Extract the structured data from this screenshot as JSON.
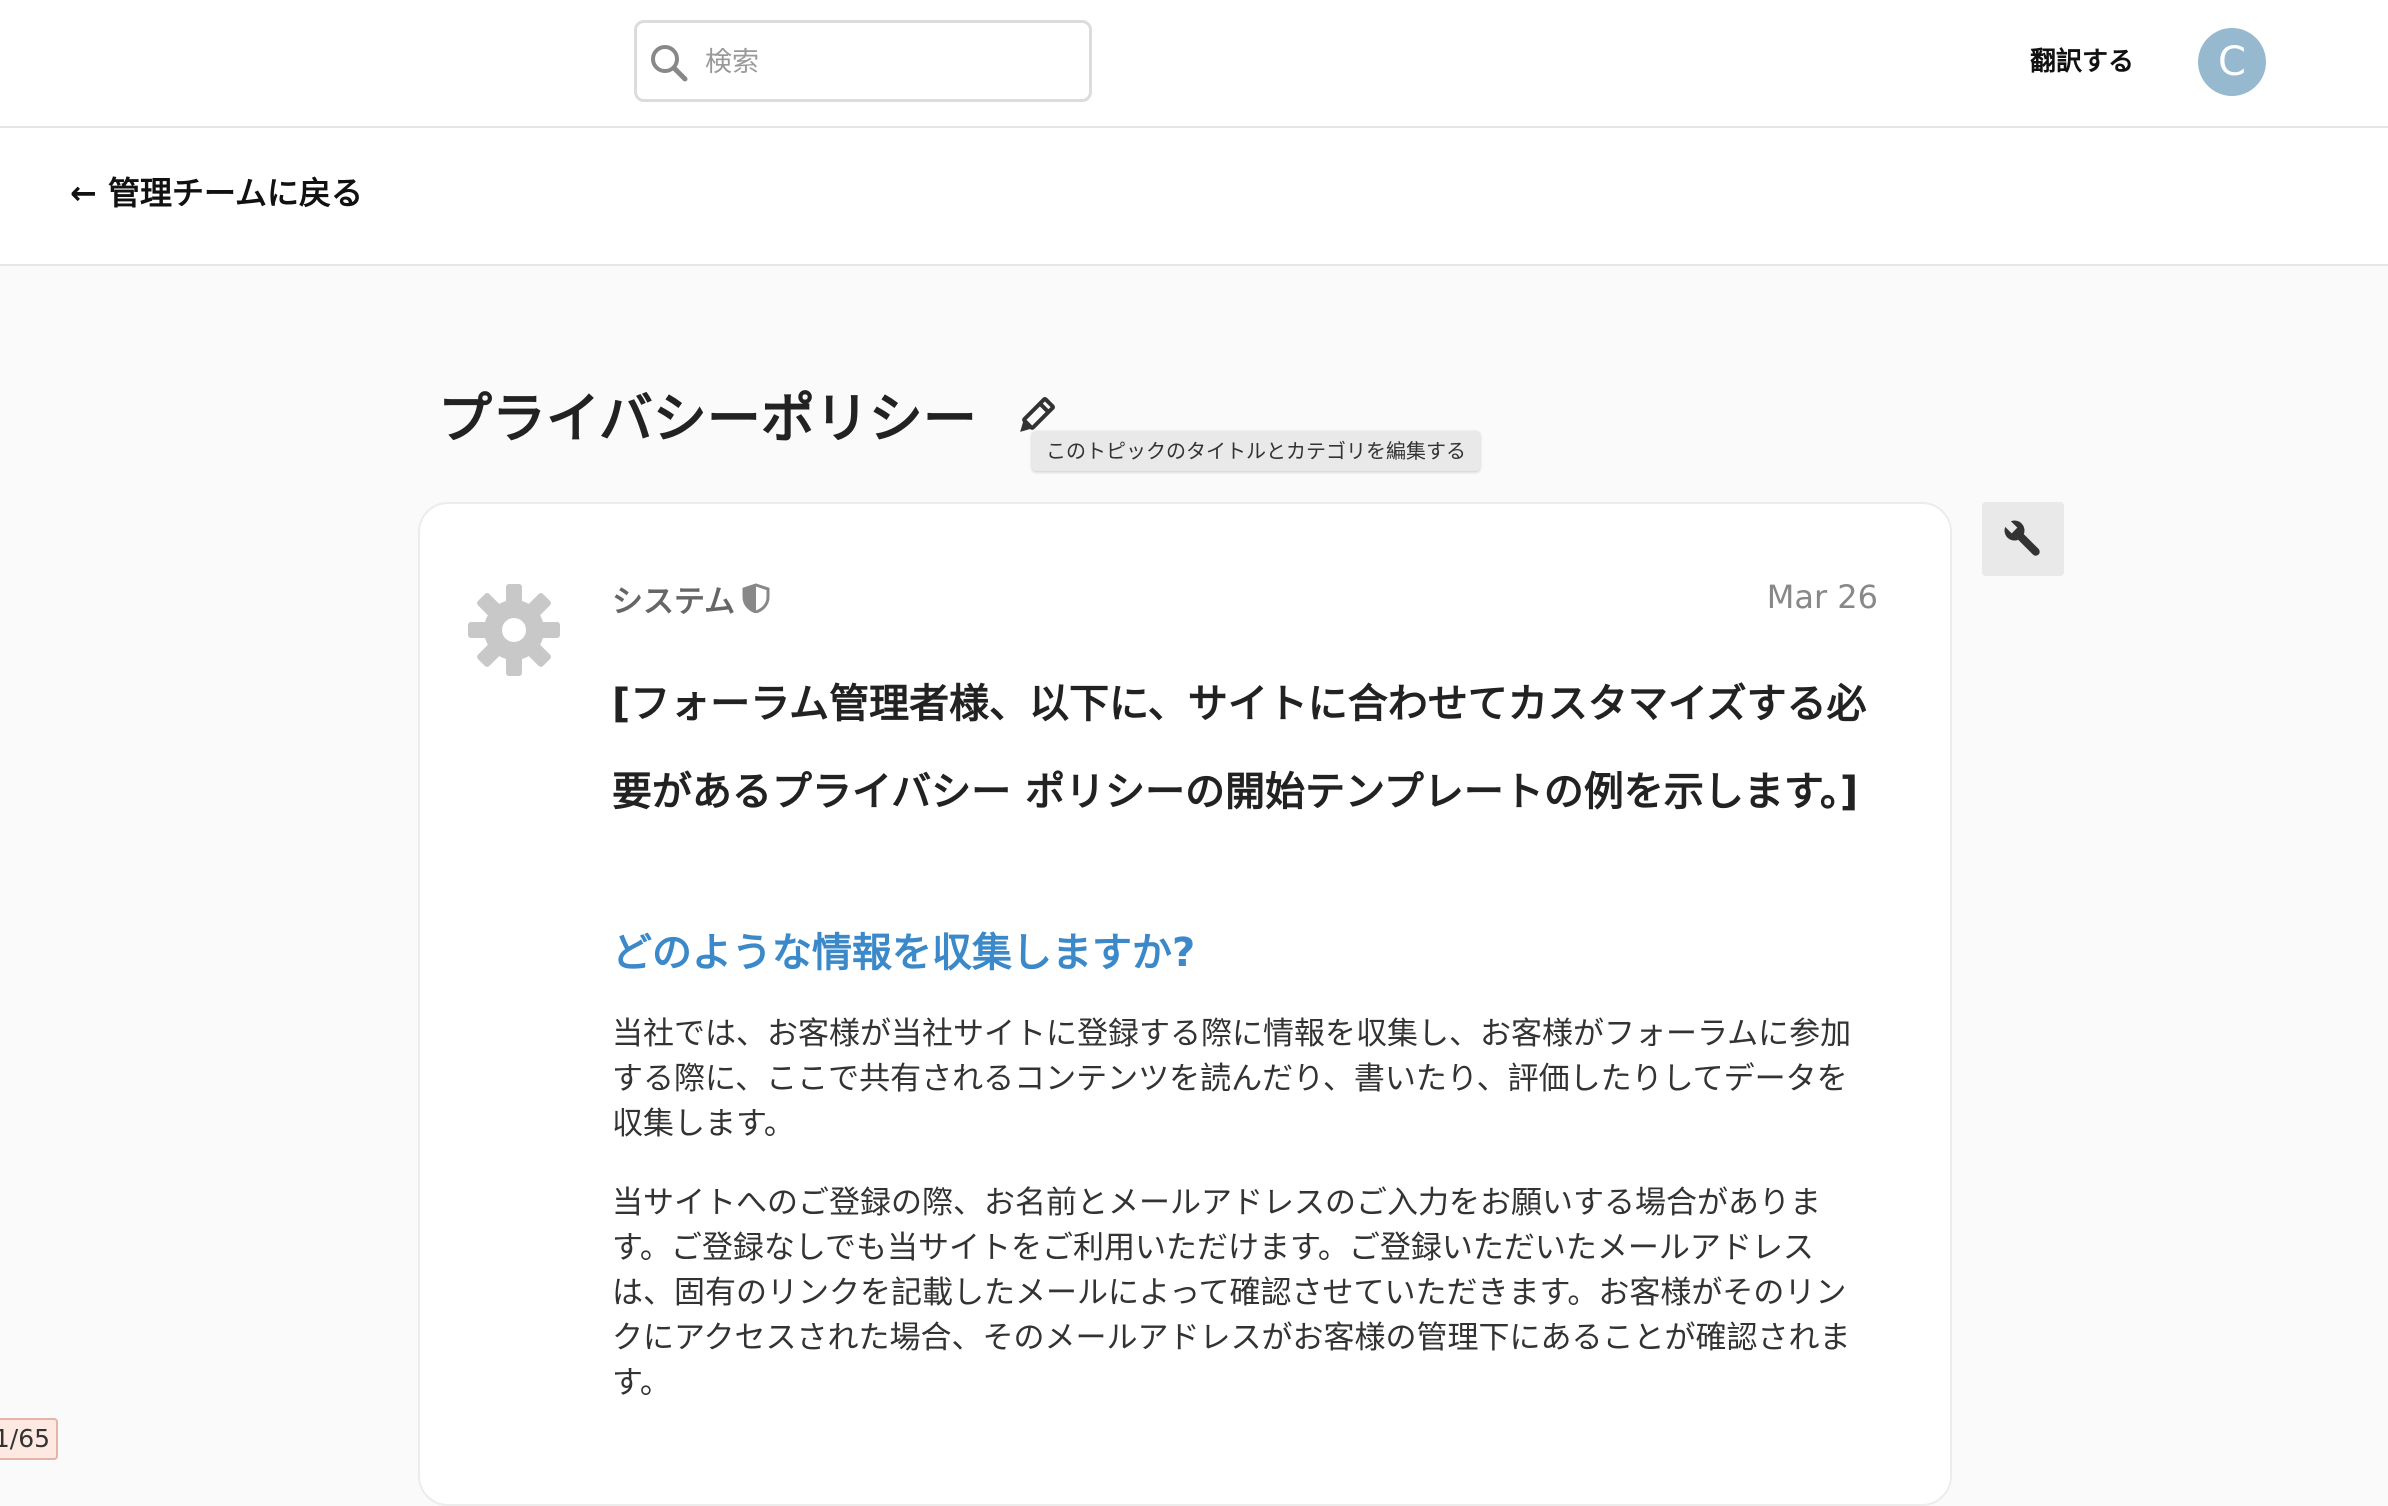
{
  "header": {
    "search": {
      "placeholder": "検索",
      "icon": "search-icon"
    },
    "translate_label": "翻訳する",
    "avatar_letter": "C",
    "avatar_color": "#96b9cf"
  },
  "subheader": {
    "back_link": "← 管理チームに戻る"
  },
  "topic": {
    "title": "プライバシーポリシー",
    "edit_icon": "pencil-icon",
    "edit_tooltip": "このトピックのタイトルとカテゴリを編集する"
  },
  "post": {
    "author": "システム",
    "author_icon": "gear-icon",
    "moderator_icon": "shield-icon",
    "date": "Mar 26",
    "intro": "[フォーラム管理者様、以下に、サイトに合わせてカスタマイズする必要があるプライバシー ポリシーの開始テンプレートの例を示します。]",
    "heading": "どのような情報を収集しますか?",
    "heading_color": "#3b89c9",
    "paragraphs": [
      "当社では、お客様が当社サイトに登録する際に情報を収集し、お客様がフォーラムに参加する際に、ここで共有されるコンテンツを読んだり、書いたり、評価したりしてデータを収集します。",
      "当サイトへのご登録の際、お名前とメールアドレスのご入力をお願いする場合があります。ご登録なしでも当サイトをご利用いただけます。ご登録いただいたメールアドレスは、固有のリンクを記載したメールによって確認させていただきます。お客様がそのリンクにアクセスされた場合、そのメールアドレスがお客様の管理下にあることが確認されます。"
    ]
  },
  "admin_button_icon": "wrench-icon",
  "progress": {
    "label": "1/65"
  }
}
